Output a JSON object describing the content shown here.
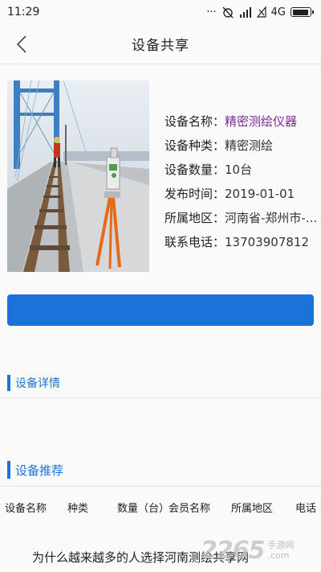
{
  "status_bar": {
    "time": "11:29",
    "network": "4G",
    "battery_level": 0.95
  },
  "header": {
    "title": "设备共享"
  },
  "device": {
    "fields": [
      {
        "key": "设备名称：",
        "value": "精密测绘仪器"
      },
      {
        "key": "设备种类：",
        "value": "精密测绘"
      },
      {
        "key": "设备数量：",
        "value": "10台"
      },
      {
        "key": "发布时间：",
        "value": "2019-01-01"
      },
      {
        "key": "所属地区：",
        "value": "河南省-郑州市-..."
      },
      {
        "key": "联系电话：",
        "value": "13703907812"
      }
    ]
  },
  "sections": {
    "details_title": "设备详情",
    "recommend_title": "设备推荐"
  },
  "table": {
    "columns": [
      "设备名称",
      "种类",
      "数量（台）",
      "会员名称",
      "所属地区",
      "电话"
    ]
  },
  "footer": {
    "text": "为什么越来越多的人选择河南测绘共享网"
  },
  "watermark": {
    "number": "2265",
    "suffix": ".com",
    "label": "手游网"
  },
  "colors": {
    "accent": "#1a73d9",
    "name_highlight": "#7b2b8f"
  }
}
